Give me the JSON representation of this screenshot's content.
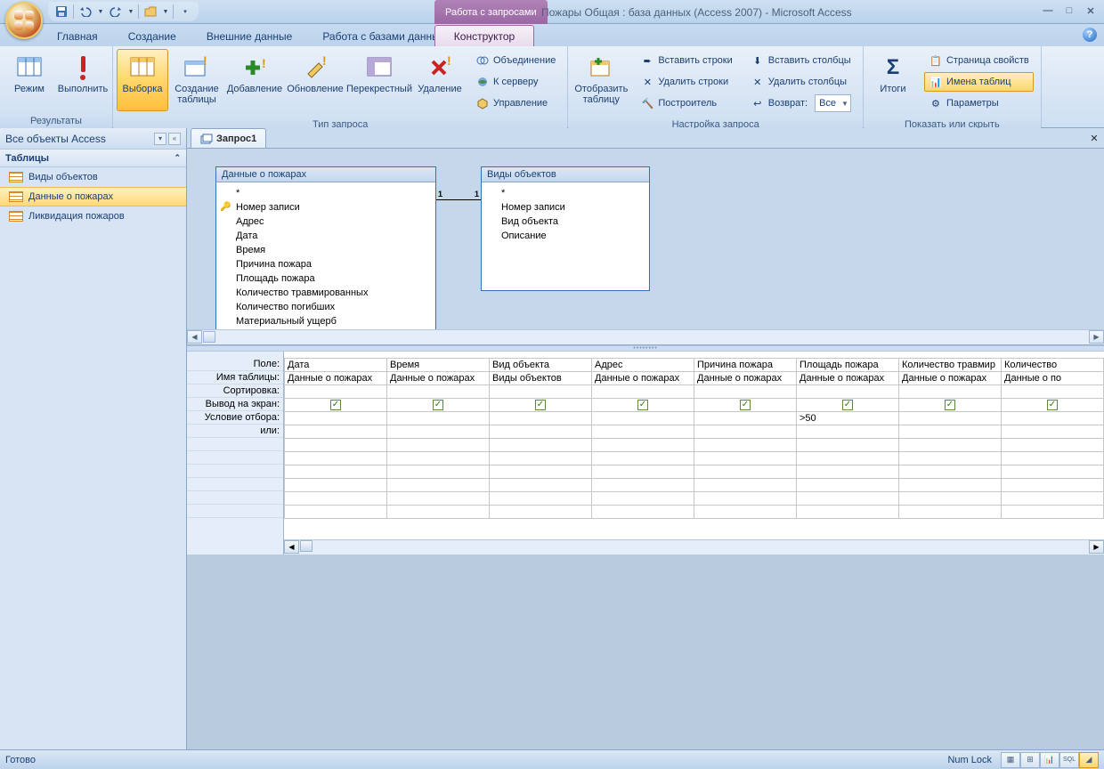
{
  "title": "Пожары Общая : база данных (Access 2007) - Microsoft Access",
  "context_tab": "Работа с запросами",
  "menu": {
    "home": "Главная",
    "create": "Создание",
    "external": "Внешние данные",
    "dbtools": "Работа с базами данных",
    "designer": "Конструктор"
  },
  "ribbon": {
    "g1": {
      "label": "Результаты",
      "view": "Режим",
      "run": "Выполнить"
    },
    "g2": {
      "label": "Тип запроса",
      "select": "Выборка",
      "maketable": "Создание таблицы",
      "append": "Добавление",
      "update": "Обновление",
      "crosstab": "Перекрестный",
      "delete": "Удаление",
      "union": "Объединение",
      "passthrough": "К серверу",
      "datadef": "Управление"
    },
    "g3": {
      "label": "Настройка запроса",
      "showtable": "Отобразить таблицу",
      "insrows": "Вставить строки",
      "delrows": "Удалить строки",
      "builder": "Построитель",
      "inscols": "Вставить столбцы",
      "delcols": "Удалить столбцы",
      "return": "Возврат:",
      "return_val": "Все"
    },
    "g4": {
      "label": "Показать или скрыть",
      "totals": "Итоги",
      "propsheet": "Страница свойств",
      "tablenames": "Имена таблиц",
      "params": "Параметры"
    }
  },
  "nav": {
    "title": "Все объекты Access",
    "section": "Таблицы",
    "items": [
      "Виды объектов",
      "Данные о пожарах",
      "Ликвидация пожаров"
    ]
  },
  "doc": {
    "tab": "Запрос1"
  },
  "tables": {
    "t1": {
      "title": "Данные о пожарах",
      "fields": [
        "*",
        "Номер записи",
        "Адрес",
        "Дата",
        "Время",
        "Причина пожара",
        "Площадь пожара",
        "Количество травмированных",
        "Количество погибших",
        "Материальный ущерб"
      ]
    },
    "t2": {
      "title": "Виды объектов",
      "fields": [
        "*",
        "Номер записи",
        "Вид объекта",
        "Описание"
      ]
    }
  },
  "grid": {
    "labels": {
      "field": "Поле:",
      "table": "Имя таблицы:",
      "sort": "Сортировка:",
      "show": "Вывод на экран:",
      "criteria": "Условие отбора:",
      "or": "или:"
    },
    "cols": [
      {
        "field": "Дата",
        "table": "Данные о пожарах",
        "show": true,
        "criteria": ""
      },
      {
        "field": "Время",
        "table": "Данные о пожарах",
        "show": true,
        "criteria": ""
      },
      {
        "field": "Вид объекта",
        "table": "Виды объектов",
        "show": true,
        "criteria": ""
      },
      {
        "field": "Адрес",
        "table": "Данные о пожарах",
        "show": true,
        "criteria": ""
      },
      {
        "field": "Причина пожара",
        "table": "Данные о пожарах",
        "show": true,
        "criteria": ""
      },
      {
        "field": "Площадь пожара",
        "table": "Данные о пожарах",
        "show": true,
        "criteria": ">50"
      },
      {
        "field": "Количество травмир",
        "table": "Данные о пожарах",
        "show": true,
        "criteria": ""
      },
      {
        "field": "Количество",
        "table": "Данные о по",
        "show": true,
        "criteria": ""
      }
    ]
  },
  "status": {
    "ready": "Готово",
    "numlock": "Num Lock"
  }
}
